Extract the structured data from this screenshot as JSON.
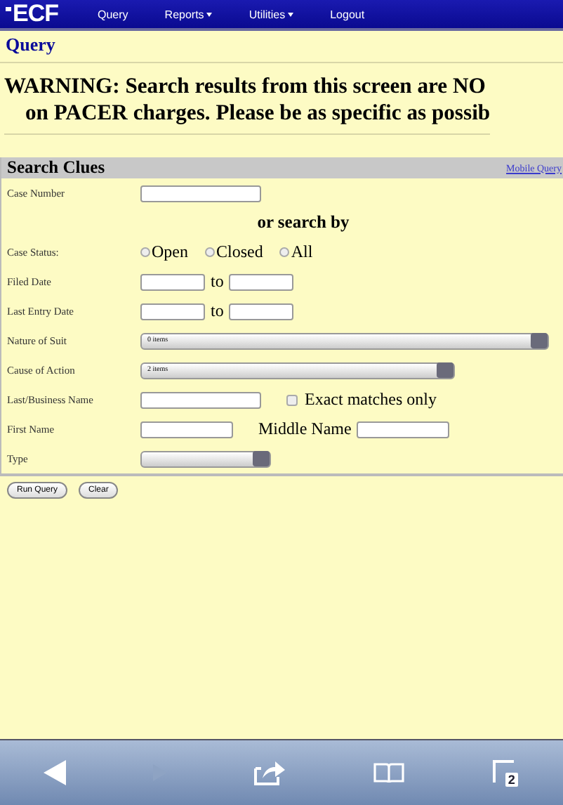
{
  "navbar": {
    "logo": "ECF",
    "menu": [
      {
        "label": "Query",
        "dropdown": false
      },
      {
        "label": "Reports",
        "dropdown": true
      },
      {
        "label": "Utilities",
        "dropdown": true
      },
      {
        "label": "Logout",
        "dropdown": false
      }
    ]
  },
  "page_title": "Query",
  "warning": [
    "WARNING: Search results from this screen are NO",
    "on PACER charges. Please be as specific as possib"
  ],
  "search_clues": {
    "title": "Search Clues",
    "link": "Mobile Query",
    "case_number": {
      "label": "Case Number"
    },
    "or_text": "or search by",
    "case_status": {
      "label": "Case Status:",
      "options": [
        {
          "label": "Open",
          "selected": false
        },
        {
          "label": "Closed",
          "selected": false
        },
        {
          "label": "All",
          "selected": false
        }
      ]
    },
    "filed_date": {
      "label": "Filed Date",
      "to": "to"
    },
    "last_entry_date": {
      "label": "Last Entry Date",
      "to": "to"
    },
    "nature_of_suit": {
      "label": "Nature of Suit",
      "value": "0 items"
    },
    "cause_of_action": {
      "label": "Cause of Action",
      "value": "2 items"
    },
    "last_name": {
      "label": "Last/Business Name",
      "exact": {
        "label": "Exact matches only",
        "checked": false
      }
    },
    "first_name": {
      "label": "First Name",
      "middle_label": "Middle Name"
    },
    "type": {
      "label": "Type"
    }
  },
  "buttons": [
    "Run Query",
    "Clear"
  ],
  "browser_toolbar": {
    "tab_count": "2"
  }
}
